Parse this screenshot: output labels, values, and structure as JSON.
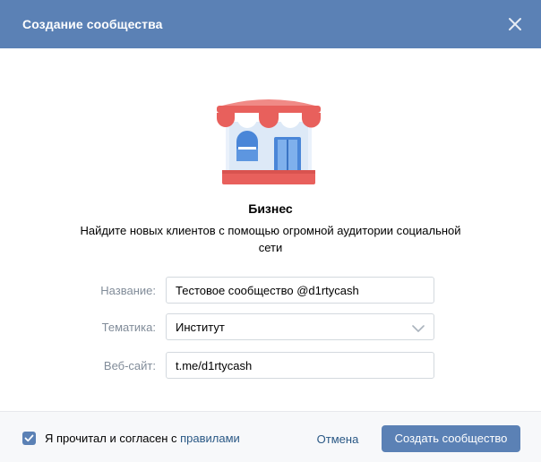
{
  "header": {
    "title": "Создание сообщества"
  },
  "content": {
    "heading": "Бизнес",
    "description": "Найдите новых клиентов с помощью огромной аудитории социальной сети"
  },
  "form": {
    "name": {
      "label": "Название:",
      "value": "Тестовое сообщество @d1rtycash"
    },
    "topic": {
      "label": "Тематика:",
      "value": "Институт"
    },
    "website": {
      "label": "Веб-сайт:",
      "value": "t.me/d1rtycash"
    }
  },
  "footer": {
    "agree_checked": true,
    "agree_text": "Я прочитал и согласен с ",
    "agree_link": "правилами",
    "cancel_label": "Отмена",
    "submit_label": "Создать сообщество"
  },
  "colors": {
    "header_bg": "#5b81b5",
    "link": "#2a5885",
    "label_gray": "#818c99",
    "awning_red": "#e8605c"
  },
  "icons": {
    "close": "close-icon",
    "dropdown": "chevron-down-icon",
    "checkbox": "check-icon",
    "illustration": "shop-illustration"
  }
}
